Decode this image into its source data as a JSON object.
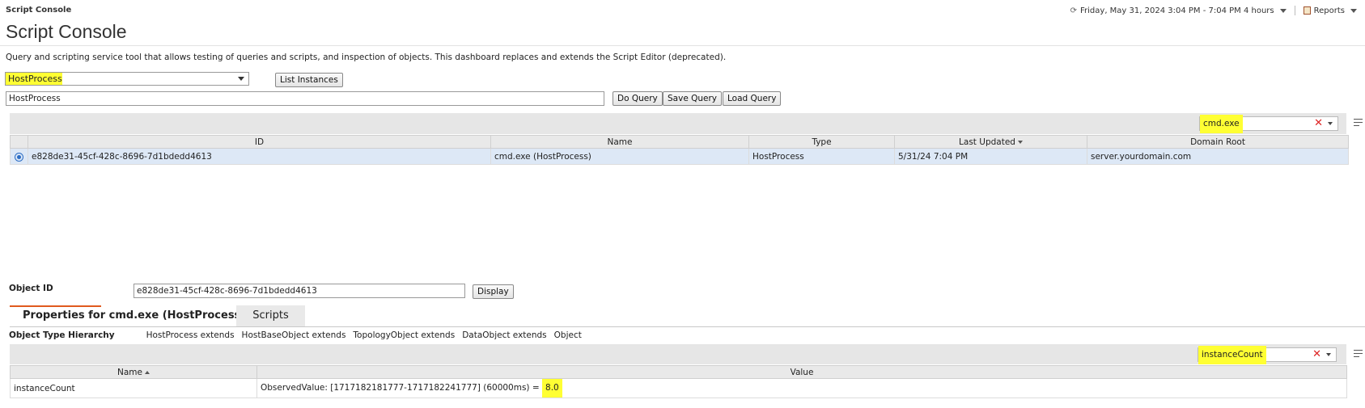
{
  "header": {
    "small_title": "Script Console",
    "page_title": "Script Console",
    "time_range": "Friday, May 31, 2024 3:04 PM - 7:04 PM 4 hours",
    "reports_label": "Reports"
  },
  "description": "Query and scripting service tool that allows testing of queries and scripts, and inspection of objects. This dashboard replaces and extends the Script Editor (deprecated).",
  "type_select": {
    "value": "HostProcess"
  },
  "buttons": {
    "list_instances": "List Instances",
    "do_query": "Do Query",
    "save_query": "Save Query",
    "load_query": "Load Query",
    "display": "Display"
  },
  "query_input": {
    "value": "HostProcess"
  },
  "instances": {
    "filter": "cmd.exe",
    "columns": [
      "ID",
      "Name",
      "Type",
      "Last Updated",
      "Domain Root"
    ],
    "rows": [
      {
        "id": "e828de31-45cf-428c-8696-7d1bdedd4613",
        "name": "cmd.exe (HostProcess)",
        "type": "HostProcess",
        "last_updated": "5/31/24 7:04 PM",
        "domain_root": "server.yourdomain.com"
      }
    ]
  },
  "object_id": {
    "label": "Object ID",
    "value": "e828de31-45cf-428c-8696-7d1bdedd4613"
  },
  "tabs": [
    {
      "label": "Properties for cmd.exe (HostProcess)"
    },
    {
      "label": "Scripts"
    }
  ],
  "hierarchy": {
    "label": "Object Type Hierarchy",
    "items": [
      "HostProcess extends",
      "HostBaseObject extends",
      "TopologyObject extends",
      "DataObject extends",
      "Object"
    ]
  },
  "properties": {
    "filter": "instanceCount",
    "columns": [
      "Name",
      "Value"
    ],
    "rows": [
      {
        "name": "instanceCount",
        "value_prefix": "ObservedValue: [1717182181777-1717182241777] (60000ms) =",
        "value_result": "8.0"
      }
    ]
  },
  "colors": {
    "highlight": "#ffff33",
    "selected_row": "#dde8f6",
    "tab_accent": "#e05a1e"
  }
}
